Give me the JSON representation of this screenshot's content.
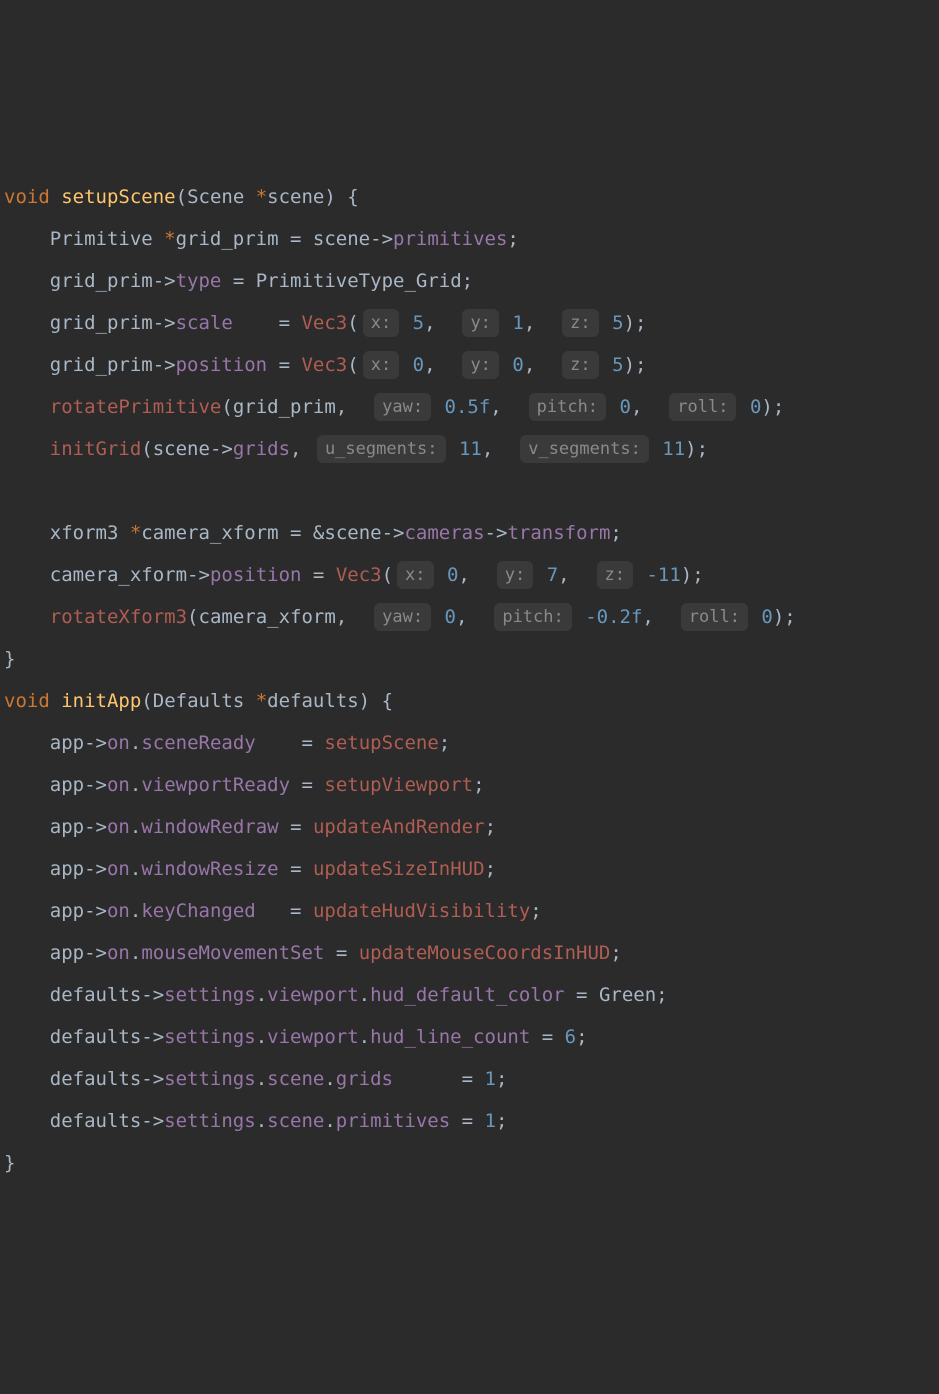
{
  "code": {
    "l1_kw_void": "void",
    "l1_fn": "setupScene",
    "l1_paren_o": "(",
    "l1_type": "Scene",
    "l1_star": " *",
    "l1_param": "scene",
    "l1_paren_c": ")",
    "l1_brace": " {",
    "l2_type": "Primitive",
    "l2_star": " *",
    "l2_var": "grid_prim",
    "l2_eq": "=",
    "l2_rhs1": "scene",
    "l2_arrow": "->",
    "l2_rhs2": "primitives",
    "l2_semi": ";",
    "l3_lhs": "grid_prim",
    "l3_arrow": "->",
    "l3_mem": "type",
    "l3_eq": "=",
    "l3_rhs": "PrimitiveType_Grid",
    "l3_semi": ";",
    "l4_lhs": "grid_prim",
    "l4_arrow": "->",
    "l4_mem": "scale",
    "l4_eq": "=",
    "l4_call": "Vec3",
    "l4_paren_o": "(",
    "l4_h1": "x:",
    "l4_a1": "5",
    "l4_c1": ",",
    "l4_h2": "y:",
    "l4_a2": "1",
    "l4_c2": ",",
    "l4_h3": "z:",
    "l4_a3": "5",
    "l4_paren_c": ")",
    "l4_semi": ";",
    "l5_lhs": "grid_prim",
    "l5_arrow": "->",
    "l5_mem": "position",
    "l5_eq": "=",
    "l5_call": "Vec3",
    "l5_paren_o": "(",
    "l5_h1": "x:",
    "l5_a1": "0",
    "l5_c1": ",",
    "l5_h2": "y:",
    "l5_a2": "0",
    "l5_c2": ",",
    "l5_h3": "z:",
    "l5_a3": "5",
    "l5_paren_c": ")",
    "l5_semi": ";",
    "l6_call": "rotatePrimitive",
    "l6_paren_o": "(",
    "l6_a0": "grid_prim",
    "l6_c0": ",",
    "l6_h1": "yaw:",
    "l6_a1": "0.5f",
    "l6_c1": ",",
    "l6_h2": "pitch:",
    "l6_a2": "0",
    "l6_c2": ",",
    "l6_h3": "roll:",
    "l6_a3": "0",
    "l6_paren_c": ")",
    "l6_semi": ";",
    "l7_call": "initGrid",
    "l7_paren_o": "(",
    "l7_a0a": "scene",
    "l7_a0arrow": "->",
    "l7_a0b": "grids",
    "l7_c0": ",",
    "l7_h1": "u_segments:",
    "l7_a1": "11",
    "l7_c1": ",",
    "l7_h2": "v_segments:",
    "l7_a2": "11",
    "l7_paren_c": ")",
    "l7_semi": ";",
    "l8_type": "xform3",
    "l8_star": " *",
    "l8_var": "camera_xform",
    "l8_eq": "=",
    "l8_amp": " &",
    "l8_r1": "scene",
    "l8_ar1": "->",
    "l8_r2": "cameras",
    "l8_ar2": "->",
    "l8_r3": "transform",
    "l8_semi": ";",
    "l9_lhs": "camera_xform",
    "l9_arrow": "->",
    "l9_mem": "position",
    "l9_eq": "=",
    "l9_call": "Vec3",
    "l9_paren_o": "(",
    "l9_h1": "x:",
    "l9_a1": "0",
    "l9_c1": ",",
    "l9_h2": "y:",
    "l9_a2": "7",
    "l9_c2": ",",
    "l9_h3": "z:",
    "l9_a3": "-11",
    "l9_paren_c": ")",
    "l9_semi": ";",
    "l10_call": "rotateXform3",
    "l10_paren_o": "(",
    "l10_a0": "camera_xform",
    "l10_c0": ",",
    "l10_h1": "yaw:",
    "l10_a1": "0",
    "l10_c1": ",",
    "l10_h2": "pitch:",
    "l10_a2": "-0.2f",
    "l10_c2": ",",
    "l10_h3": "roll:",
    "l10_a3": "0",
    "l10_paren_c": ")",
    "l10_semi": ";",
    "l11_brace": "}",
    "l12_kw_void": "void",
    "l12_fn": "initApp",
    "l12_paren_o": "(",
    "l12_type": "Defaults",
    "l12_star": " *",
    "l12_param": "defaults",
    "l12_paren_c": ")",
    "l12_brace": " {",
    "a1_l": "app",
    "a_ar": "->",
    "a1_on": "on",
    "a_dot": ".",
    "a1_m": "sceneReady",
    "a_eq": "=",
    "a1_r": "setupScene",
    "a_semi": ";",
    "a2_m": "viewportReady",
    "a2_r": "setupViewport",
    "a3_m": "windowRedraw",
    "a3_r": "updateAndRender",
    "a4_m": "windowResize",
    "a4_r": "updateSizeInHUD",
    "a5_m": "keyChanged",
    "a5_r": "updateHudVisibility",
    "a6_m": "mouseMovementSet",
    "a6_r": "updateMouseCoordsInHUD",
    "d_l": "defaults",
    "d_s": "settings",
    "d_v": "viewport",
    "d1_m": "hud_default_color",
    "d1_r": "Green",
    "d2_m": "hud_line_count",
    "d2_r": "6",
    "d_sc": "scene",
    "d3_m": "grids",
    "d3_r": "1",
    "d4_m": "primitives",
    "d4_r": "1",
    "lend_brace": "}"
  }
}
